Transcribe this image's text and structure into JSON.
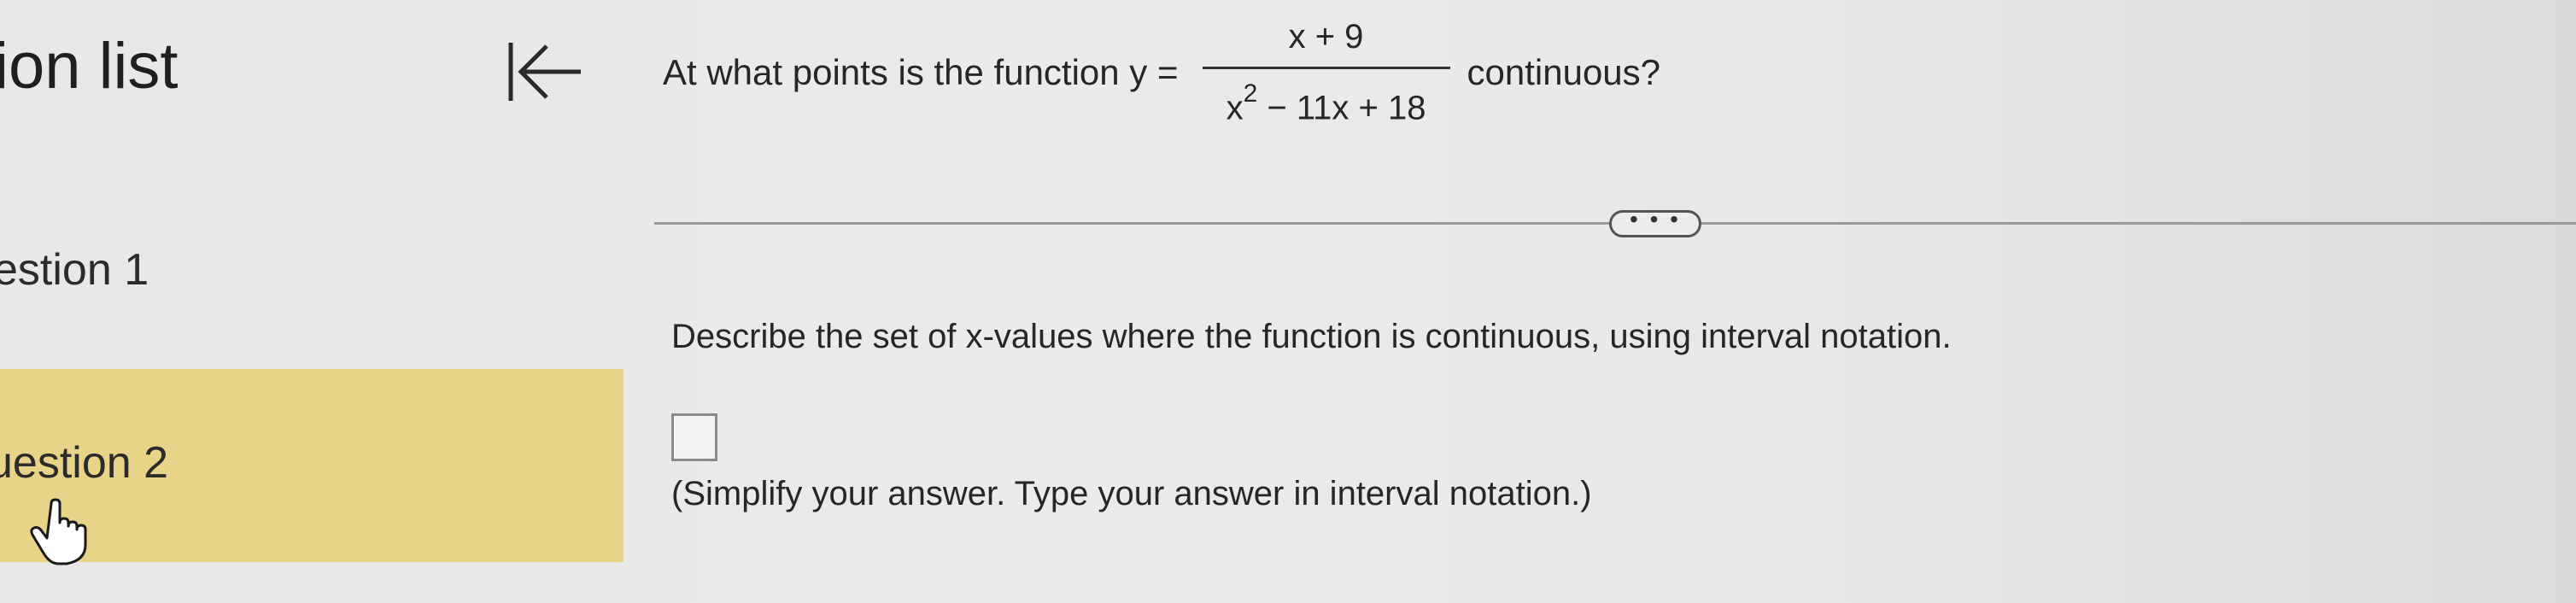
{
  "sidebar": {
    "title": "tion list",
    "items": [
      {
        "label": "estion 1"
      },
      {
        "label": "uestion 2"
      }
    ]
  },
  "question": {
    "prefix": "At what points is the function y =",
    "numerator": "x + 9",
    "denominator_x": "x",
    "denominator_exp": "2",
    "denominator_rest": " − 11x + 18",
    "suffix": "continuous?"
  },
  "more_button": {
    "label": "• • •"
  },
  "instruction": "Describe the set of x-values where the function is continuous, using interval notation.",
  "answer": {
    "value": ""
  },
  "hint": "(Simplify your answer. Type your answer in interval notation.)",
  "icons": {
    "collapse": "collapse-left-icon",
    "cursor": "hand-pointer-icon"
  }
}
